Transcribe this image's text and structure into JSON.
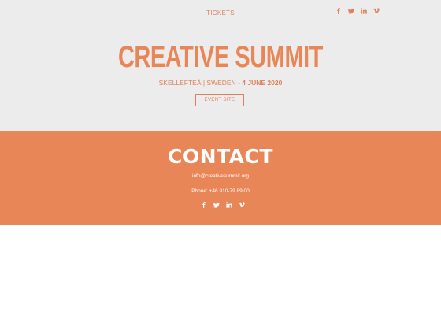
{
  "nav": {
    "tickets_label": "TICKETS",
    "social": [
      "facebook-icon",
      "twitter-icon",
      "linkedin-icon",
      "vimeo-icon"
    ]
  },
  "hero": {
    "title": "CREATIVE SUMMIT",
    "location": "SKELLEFTEÅ | SWEDEN - ",
    "date": "4 JUNE 2020",
    "event_button_label": "EVENT SITE"
  },
  "contact": {
    "title": "CONTACT",
    "email": "info@creativesummit.org",
    "phone": "Phone: +46 910-79 89 00",
    "social": [
      "facebook-icon",
      "twitter-icon",
      "linkedin-icon",
      "vimeo-icon"
    ]
  },
  "colors": {
    "accent": "#e98657",
    "accent_text": "#e0805a",
    "hero_bg": "#ececec",
    "page_bg": "#ffffff"
  }
}
